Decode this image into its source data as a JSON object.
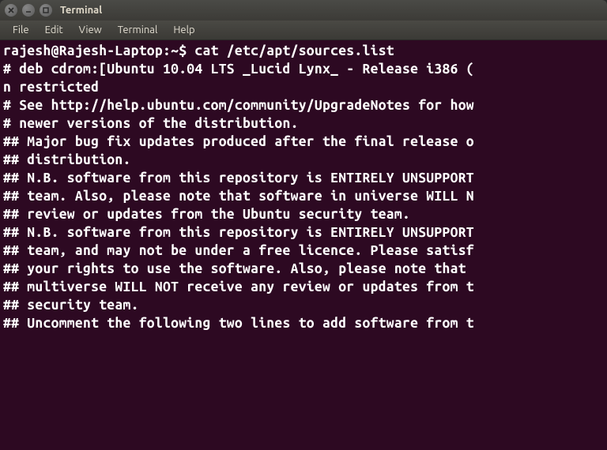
{
  "window": {
    "title": "Terminal"
  },
  "menubar": {
    "items": [
      "File",
      "Edit",
      "View",
      "Terminal",
      "Help"
    ]
  },
  "terminal": {
    "lines": [
      "rajesh@Rajesh-Laptop:~$ cat /etc/apt/sources.list",
      "# deb cdrom:[Ubuntu 10.04 LTS _Lucid Lynx_ - Release i386 (",
      "n restricted",
      "# See http://help.ubuntu.com/community/UpgradeNotes for how",
      "# newer versions of the distribution.",
      "",
      "",
      "## Major bug fix updates produced after the final release o",
      "## distribution.",
      "",
      "## N.B. software from this repository is ENTIRELY UNSUPPORT",
      "## team. Also, please note that software in universe WILL N",
      "## review or updates from the Ubuntu security team.",
      "",
      "## N.B. software from this repository is ENTIRELY UNSUPPORT",
      "## team, and may not be under a free licence. Please satisf",
      "## your rights to use the software. Also, please note that ",
      "## multiverse WILL NOT receive any review or updates from t",
      "## security team.",
      "",
      "## Uncomment the following two lines to add software from t"
    ]
  }
}
